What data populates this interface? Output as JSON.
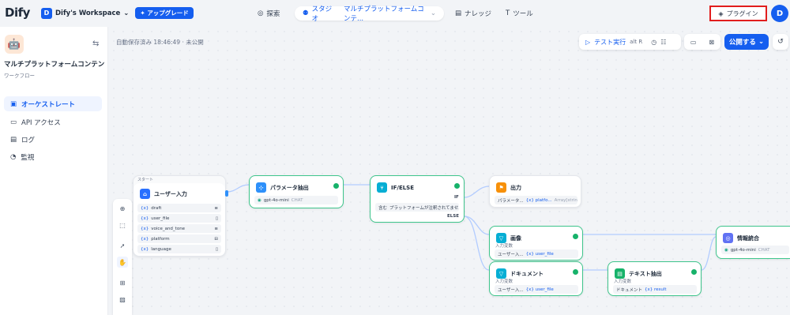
{
  "brand": {
    "logo": "Dify"
  },
  "workspace": {
    "avatar_letter": "D",
    "name": "Dify's Workspace",
    "upgrade_label": "アップグレード"
  },
  "nav": {
    "explore": "探索",
    "studio": "スタジオ",
    "current_app": "マルチプラットフォームコンテ...",
    "knowledge": "ナレッジ",
    "tools": "ツール"
  },
  "plugin_label": "プラグイン",
  "user_avatar": "D",
  "app": {
    "name": "マルチプラットフォームコンテンツジ...",
    "type": "ワークフロー"
  },
  "menu": [
    {
      "label": "オーケストレート",
      "active": true
    },
    {
      "label": "API アクセス",
      "active": false
    },
    {
      "label": "ログ",
      "active": false
    },
    {
      "label": "監視",
      "active": false
    }
  ],
  "toolbar": {
    "autosave": "自動保存済み 18:46:49 · 未公開",
    "test_run": "テスト実行",
    "shortcut": "alt R",
    "publish": "公開する"
  },
  "nodes": {
    "start": {
      "tag": "スタート",
      "title": "ユーザー入力",
      "vars": [
        {
          "name": "draft",
          "type": "≡"
        },
        {
          "name": "user_file",
          "type": "▯"
        },
        {
          "name": "voice_and_tone",
          "type": "≡"
        },
        {
          "name": "platform",
          "type": "⊟"
        },
        {
          "name": "language",
          "type": "▯"
        }
      ]
    },
    "param": {
      "title": "パラメータ抽出",
      "model": "gpt-4o-mini",
      "mode": "CHAT"
    },
    "ifelse": {
      "title": "IF/ELSE",
      "if_label": "IF",
      "condition_prefix": "含む",
      "condition": "プラットフォームが注釈されてませ...",
      "else_label": "ELSE"
    },
    "output": {
      "title": "出力",
      "var_label": "パラメータ...",
      "var": "{x} platfo...",
      "type": "Array[string]"
    },
    "image": {
      "title": "画像",
      "input_label": "入力変数",
      "src": "ユーザー入...",
      "var": "{x} user_file"
    },
    "document": {
      "title": "ドキュメント",
      "input_label": "入力変数",
      "src": "ユーザー入...",
      "var": "{x} user_file"
    },
    "text_extract": {
      "title": "テキスト抽出",
      "input_label": "入力変数",
      "src": "ドキュメント",
      "var": "{x} result"
    },
    "info": {
      "title": "情報統合",
      "model": "gpt-4o-mini",
      "mode": "CHAT"
    }
  },
  "colors": {
    "primary": "#155eef",
    "success": "#17b26a",
    "highlight": "#e11d1d"
  }
}
